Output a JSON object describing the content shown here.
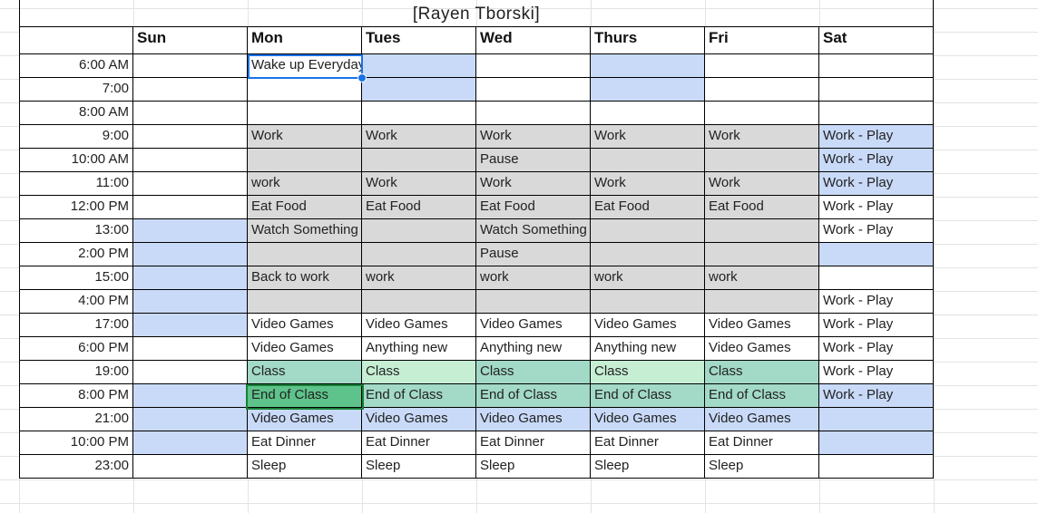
{
  "title": "[Rayen Tborski]",
  "days": [
    "Sun",
    "Mon",
    "Tues",
    "Wed",
    "Thurs",
    "Fri",
    "Sat"
  ],
  "colors": {
    "blue": "#c9daf8",
    "gray": "#d9d9d9",
    "teal": "#a2d9c7",
    "mint": "#c5eed3",
    "green": "#5ec38a",
    "white": "#ffffff",
    "grid": "#e2e3e3"
  },
  "rows": [
    {
      "time": "6:00 AM",
      "cells": [
        [
          "",
          ""
        ],
        [
          "Wake up Everyday at six",
          ""
        ],
        [
          "",
          "blue"
        ],
        [
          "",
          ""
        ],
        [
          "",
          "blue"
        ],
        [
          "",
          ""
        ],
        [
          "",
          ""
        ]
      ]
    },
    {
      "time": "7:00",
      "cells": [
        [
          "",
          ""
        ],
        [
          "",
          ""
        ],
        [
          "",
          "blue"
        ],
        [
          "",
          ""
        ],
        [
          "",
          "blue"
        ],
        [
          "",
          ""
        ],
        [
          "",
          ""
        ]
      ]
    },
    {
      "time": "8:00 AM",
      "cells": [
        [
          "",
          ""
        ],
        [
          "",
          ""
        ],
        [
          "",
          ""
        ],
        [
          "",
          ""
        ],
        [
          "",
          ""
        ],
        [
          "",
          ""
        ],
        [
          "",
          ""
        ]
      ]
    },
    {
      "time": "9:00",
      "cells": [
        [
          "",
          ""
        ],
        [
          "Work",
          "gray"
        ],
        [
          "Work",
          "gray"
        ],
        [
          "Work",
          "gray"
        ],
        [
          "Work",
          "gray"
        ],
        [
          "Work",
          "gray"
        ],
        [
          "Work - Play",
          "blue"
        ]
      ]
    },
    {
      "time": "10:00 AM",
      "cells": [
        [
          "",
          ""
        ],
        [
          "",
          "gray"
        ],
        [
          "",
          "gray"
        ],
        [
          "Pause",
          "gray"
        ],
        [
          "",
          "gray"
        ],
        [
          "",
          "gray"
        ],
        [
          "Work - Play",
          "blue"
        ]
      ]
    },
    {
      "time": "11:00",
      "cells": [
        [
          "",
          ""
        ],
        [
          "work",
          "gray"
        ],
        [
          "Work",
          "gray"
        ],
        [
          "Work",
          "gray"
        ],
        [
          "Work",
          "gray"
        ],
        [
          "Work",
          "gray"
        ],
        [
          "Work - Play",
          "blue"
        ]
      ]
    },
    {
      "time": "12:00 PM",
      "cells": [
        [
          "",
          ""
        ],
        [
          "Eat Food",
          "gray"
        ],
        [
          "Eat Food",
          "gray"
        ],
        [
          "Eat Food",
          "gray"
        ],
        [
          "Eat Food",
          "gray"
        ],
        [
          "Eat Food",
          "gray"
        ],
        [
          "Work - Play",
          ""
        ]
      ]
    },
    {
      "time": "13:00",
      "cells": [
        [
          "",
          "blue"
        ],
        [
          "Watch Something",
          "gray"
        ],
        [
          "",
          "gray"
        ],
        [
          "Watch Something",
          "gray"
        ],
        [
          "",
          "gray"
        ],
        [
          "",
          "gray"
        ],
        [
          "Work - Play",
          ""
        ]
      ]
    },
    {
      "time": "2:00 PM",
      "cells": [
        [
          "",
          "blue"
        ],
        [
          "",
          "gray"
        ],
        [
          "",
          "gray"
        ],
        [
          "Pause",
          "gray"
        ],
        [
          "",
          "gray"
        ],
        [
          "",
          "gray"
        ],
        [
          "",
          "blue"
        ]
      ]
    },
    {
      "time": "15:00",
      "cells": [
        [
          "",
          "blue"
        ],
        [
          "Back to work",
          "gray"
        ],
        [
          "work",
          "gray"
        ],
        [
          "work",
          "gray"
        ],
        [
          "work",
          "gray"
        ],
        [
          "work",
          "gray"
        ],
        [
          "",
          ""
        ]
      ]
    },
    {
      "time": "4:00 PM",
      "cells": [
        [
          "",
          "blue"
        ],
        [
          "",
          "gray"
        ],
        [
          "",
          "gray"
        ],
        [
          "",
          "gray"
        ],
        [
          "",
          "gray"
        ],
        [
          "",
          "gray"
        ],
        [
          "Work - Play",
          ""
        ]
      ]
    },
    {
      "time": "17:00",
      "cells": [
        [
          "",
          "blue"
        ],
        [
          "Video Games",
          ""
        ],
        [
          "Video Games",
          ""
        ],
        [
          "Video Games",
          ""
        ],
        [
          "Video Games",
          ""
        ],
        [
          "Video Games",
          ""
        ],
        [
          "Work - Play",
          ""
        ]
      ]
    },
    {
      "time": "6:00 PM",
      "cells": [
        [
          "",
          ""
        ],
        [
          "Video Games",
          ""
        ],
        [
          "Anything new",
          ""
        ],
        [
          "Anything new",
          ""
        ],
        [
          "Anything new",
          ""
        ],
        [
          "Video Games",
          ""
        ],
        [
          "Work - Play",
          ""
        ]
      ]
    },
    {
      "time": "19:00",
      "cells": [
        [
          "",
          ""
        ],
        [
          "Class",
          "teal"
        ],
        [
          "Class",
          "mint"
        ],
        [
          "Class",
          "teal"
        ],
        [
          "Class",
          "mint"
        ],
        [
          "Class",
          "teal"
        ],
        [
          "Work - Play",
          ""
        ]
      ]
    },
    {
      "time": "8:00 PM",
      "cells": [
        [
          "",
          "blue"
        ],
        [
          "End of Class",
          "green"
        ],
        [
          "End of Class",
          "teal"
        ],
        [
          "End of Class",
          "teal"
        ],
        [
          "End of Class",
          "teal"
        ],
        [
          "End of Class",
          "teal"
        ],
        [
          "Work - Play",
          "blue"
        ]
      ]
    },
    {
      "time": "21:00",
      "cells": [
        [
          "",
          "blue"
        ],
        [
          "Video Games",
          "blue"
        ],
        [
          "Video Games",
          "blue"
        ],
        [
          "Video Games",
          "blue"
        ],
        [
          "Video Games",
          "blue"
        ],
        [
          "Video Games",
          "blue"
        ],
        [
          "",
          "blue"
        ]
      ]
    },
    {
      "time": "10:00 PM",
      "cells": [
        [
          "",
          "blue"
        ],
        [
          "Eat Dinner",
          ""
        ],
        [
          "Eat Dinner",
          ""
        ],
        [
          "Eat Dinner",
          ""
        ],
        [
          "Eat Dinner",
          ""
        ],
        [
          "Eat Dinner",
          ""
        ],
        [
          "",
          "blue"
        ]
      ]
    },
    {
      "time": "23:00",
      "cells": [
        [
          "",
          ""
        ],
        [
          "Sleep",
          ""
        ],
        [
          "Sleep",
          ""
        ],
        [
          "Sleep",
          ""
        ],
        [
          "Sleep",
          ""
        ],
        [
          "Sleep",
          ""
        ],
        [
          "",
          ""
        ]
      ]
    }
  ]
}
